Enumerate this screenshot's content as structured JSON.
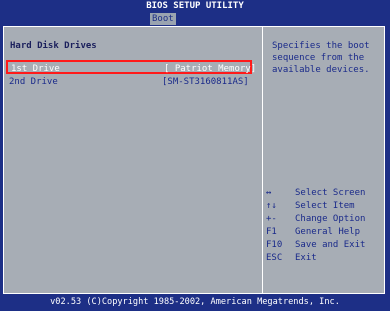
{
  "title": "BIOS SETUP UTILITY",
  "tabs": [
    {
      "label": "Boot",
      "selected": true
    }
  ],
  "section_title": "Hard Disk Drives",
  "drives": [
    {
      "label": "1st Drive",
      "value": "[ Patriot Memory]",
      "selected": true
    },
    {
      "label": "2nd Drive",
      "value": "[SM-ST3160811AS]",
      "selected": false
    }
  ],
  "help_text": "Specifies the boot\nsequence from the\navailable devices.",
  "key_help": [
    {
      "key": "↔",
      "desc": "Select Screen"
    },
    {
      "key": "↑↓",
      "desc": "Select Item"
    },
    {
      "key": "+-",
      "desc": "Change Option"
    },
    {
      "key": "F1",
      "desc": "General Help"
    },
    {
      "key": "F10",
      "desc": "Save and Exit"
    },
    {
      "key": "ESC",
      "desc": "Exit"
    }
  ],
  "footer": "v02.53 (C)Copyright 1985-2002, American Megatrends, Inc.",
  "colors": {
    "background": "#1d2f86",
    "panel": "#a7adb5",
    "highlight_border": "#ff1a1a",
    "text_dark": "#1a2a8a",
    "text_light": "#ffffff"
  }
}
